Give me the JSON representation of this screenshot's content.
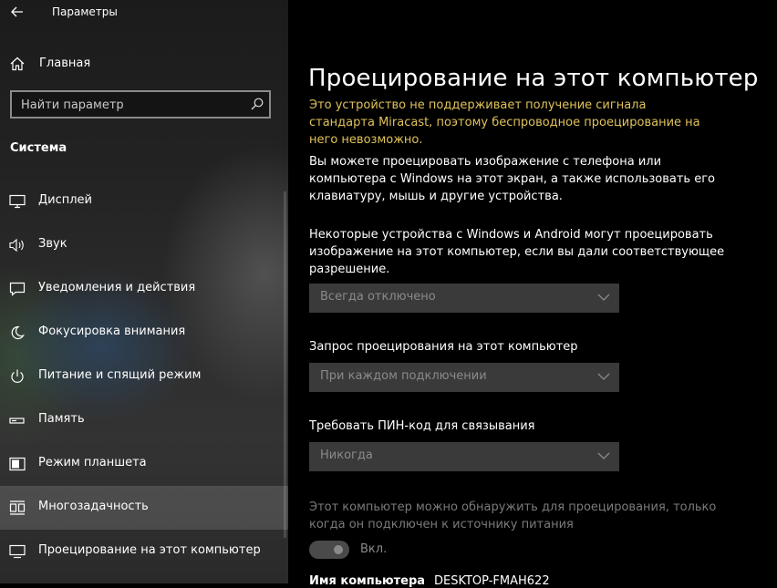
{
  "window": {
    "title": "Параметры"
  },
  "sidebar": {
    "home_label": "Главная",
    "search_placeholder": "Найти параметр",
    "section_title": "Система",
    "items": [
      {
        "label": "Дисплей",
        "icon": "monitor-icon"
      },
      {
        "label": "Звук",
        "icon": "speaker-icon"
      },
      {
        "label": "Уведомления и действия",
        "icon": "notification-icon"
      },
      {
        "label": "Фокусировка внимания",
        "icon": "moon-icon"
      },
      {
        "label": "Питание и спящий режим",
        "icon": "power-icon"
      },
      {
        "label": "Память",
        "icon": "storage-icon"
      },
      {
        "label": "Режим планшета",
        "icon": "tablet-icon"
      },
      {
        "label": "Многозадачность",
        "icon": "multitasking-icon"
      },
      {
        "label": "Проецирование на этот компьютер",
        "icon": "projecting-icon"
      }
    ]
  },
  "main": {
    "title": "Проецирование на этот компьютер",
    "warning": "Это устройство не поддерживает получение сигнала стандарта Miracast, поэтому беспроводное проецирование на него невозможно.",
    "description": "Вы можете проецировать изображение с телефона или компьютера с Windows на этот экран, а также использовать его клавиатуру, мышь и другие устройства.",
    "permission_text": "Некоторые устройства с Windows и Android могут проецировать изображение на этот компьютер, если вы дали соответствующее разрешение.",
    "permission_value": "Всегда отключено",
    "request_label": "Запрос проецирования на этот компьютер",
    "request_value": "При каждом подключении",
    "pin_label": "Требовать ПИН-код для связывания",
    "pin_value": "Никогда",
    "power_text": "Этот компьютер можно обнаружить для проецирования, только когда он подключен к источнику питания",
    "power_toggle_label": "Вкл.",
    "pc_name_label": "Имя компьютера",
    "pc_name_value": "DESKTOP-FMAH622"
  },
  "colors": {
    "warning": "#e0c25a",
    "dropdown_bg": "#3a3a3a",
    "disabled_text": "#7a7a7a"
  }
}
